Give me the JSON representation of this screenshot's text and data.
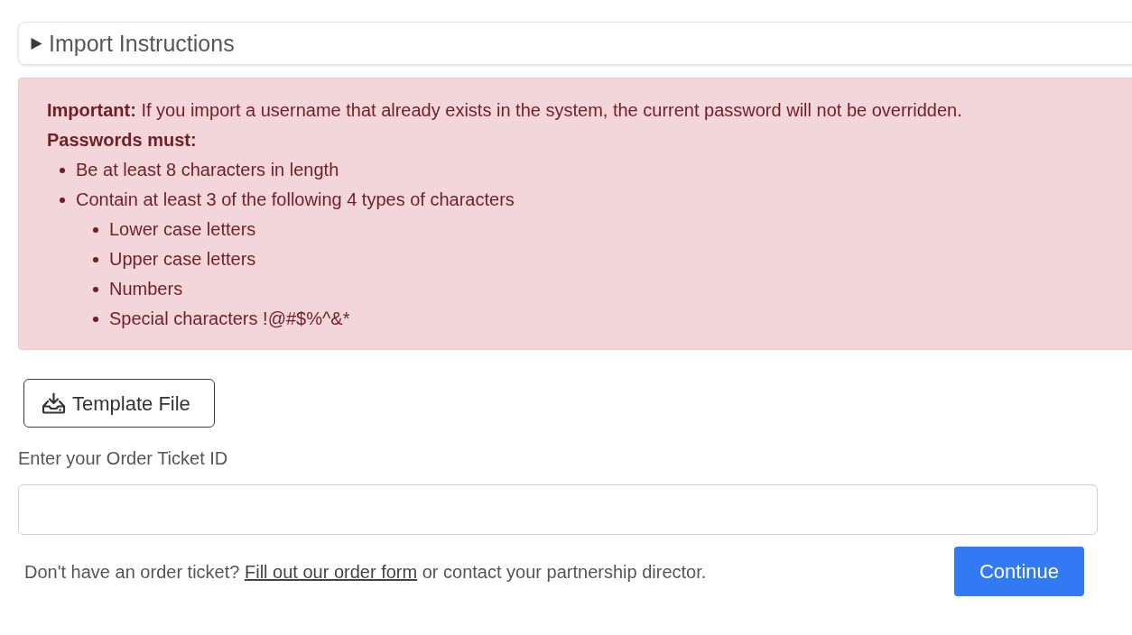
{
  "instructions": {
    "title": "Import Instructions",
    "expanded": false
  },
  "alert": {
    "note": "**Important:** If you import a username that already exists in the system, the current password will not be overridden.",
    "heading": "Passwords must:",
    "rules": [
      {
        "text": "Be at least 8 characters in length"
      },
      {
        "text": "Contain at least 3 of the following 4 types of characters",
        "children": [
          {
            "text": "Lower case letters"
          },
          {
            "text": "Upper case letters"
          },
          {
            "text": "Numbers"
          },
          {
            "text": "Special characters !@#$%^&*"
          }
        ]
      }
    ]
  },
  "template_button": {
    "label": "Template File"
  },
  "order_ticket": {
    "label": "Enter your Order Ticket ID"
  },
  "footer": {
    "before": "Don't have an order ticket?",
    "link": "Fill out our order form",
    "after": "or contact your partnership director."
  },
  "buttons": [
    {
      "label": "Continue",
      "kind": "primary"
    }
  ]
}
